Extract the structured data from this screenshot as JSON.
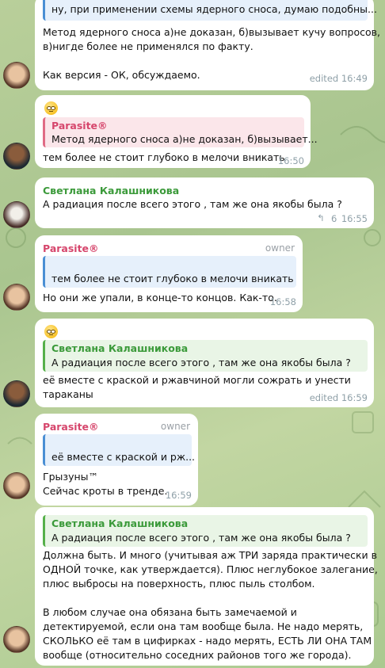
{
  "colors": {
    "tg_green": "#3b9a3a",
    "tg_pink": "#d6466c",
    "meta_gray": "#8fa0a8"
  },
  "messages": [
    {
      "reply_text": "ну, при применении схемы ядерного сноса, думаю подобны...",
      "lines": [
        "Метод ядерного сноса а)не доказан, б)вызывает кучу вопросов,",
        "в)нигде более не применялся по факту.",
        "",
        "Как версия - ОК, обсуждаемо."
      ],
      "time": "edited 16:49"
    },
    {
      "reply_name": "Parasite®",
      "reply_text": "Метод ядерного сноса а)не доказан, б)вызывает...",
      "text": "тем более не стоит глубоко в мелочи вникать",
      "time": "16:50"
    },
    {
      "sender": "Светлана Калашникова",
      "text": "А радиация после всего этого , там же она якобы была ?",
      "reply_count": "6",
      "time": "16:55"
    },
    {
      "sender": "Parasite®",
      "role": "owner",
      "reply_text": "тем более не стоит глубоко в мелочи вникать",
      "text": "Но они же упали, в конце-то концов. Как-то.",
      "time": "16:58"
    },
    {
      "reply_name": "Светлана Калашникова",
      "reply_text": "А радиация после всего этого , там же она якобы была ?",
      "lines": [
        "её вместе с краской и ржавчиной могли сожрать и унести",
        "тараканы"
      ],
      "time": "edited 16:59"
    },
    {
      "sender": "Parasite®",
      "role": "owner",
      "reply_text": "её вместе с краской и рж...",
      "lines": [
        "Грызуны™",
        "Сейчас кроты в тренде."
      ],
      "time": "16:59"
    },
    {
      "reply_name": "Светлана Калашникова",
      "reply_text": "А радиация после всего этого , там же она якобы была ?",
      "lines": [
        "Должна быть. И много (учитывая аж ТРИ заряда практически в",
        "ОДНОЙ точке, как утверждается). Плюс неглубокое залегание,",
        "плюс выбросы на поверхность, плюс пыль столбом.",
        "",
        "В любом случае она обязана быть замечаемой и",
        "детектируемой, если она там вообще была. Не надо мерять,",
        "СКОЛЬКО её там в цифирках - надо мерять, ЕСТЬ ЛИ ОНА ТАМ",
        "вообще (относительно соседних районов того же города)."
      ]
    }
  ]
}
